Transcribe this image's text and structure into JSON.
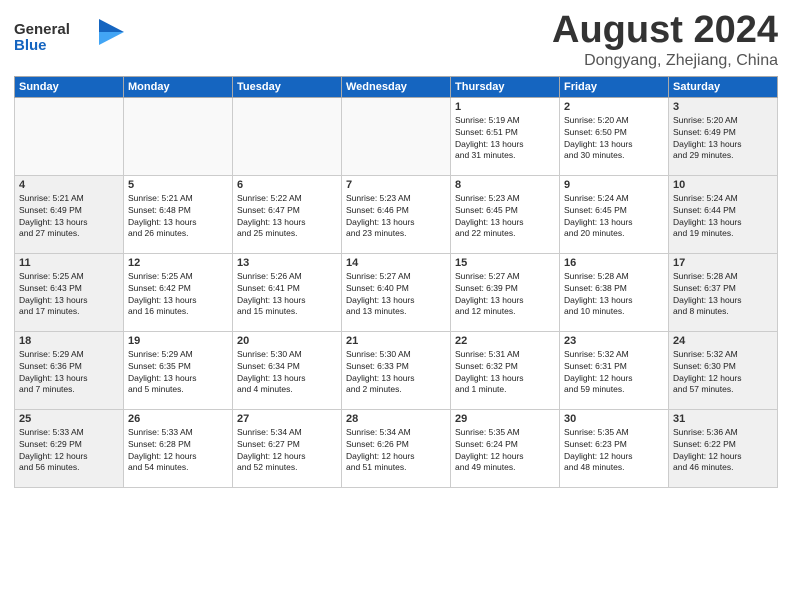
{
  "header": {
    "logo_line1": "General",
    "logo_line2": "Blue",
    "month": "August 2024",
    "location": "Dongyang, Zhejiang, China"
  },
  "days_of_week": [
    "Sunday",
    "Monday",
    "Tuesday",
    "Wednesday",
    "Thursday",
    "Friday",
    "Saturday"
  ],
  "weeks": [
    [
      {
        "day": "",
        "info": ""
      },
      {
        "day": "",
        "info": ""
      },
      {
        "day": "",
        "info": ""
      },
      {
        "day": "",
        "info": ""
      },
      {
        "day": "1",
        "info": "Sunrise: 5:19 AM\nSunset: 6:51 PM\nDaylight: 13 hours\nand 31 minutes."
      },
      {
        "day": "2",
        "info": "Sunrise: 5:20 AM\nSunset: 6:50 PM\nDaylight: 13 hours\nand 30 minutes."
      },
      {
        "day": "3",
        "info": "Sunrise: 5:20 AM\nSunset: 6:49 PM\nDaylight: 13 hours\nand 29 minutes."
      }
    ],
    [
      {
        "day": "4",
        "info": "Sunrise: 5:21 AM\nSunset: 6:49 PM\nDaylight: 13 hours\nand 27 minutes."
      },
      {
        "day": "5",
        "info": "Sunrise: 5:21 AM\nSunset: 6:48 PM\nDaylight: 13 hours\nand 26 minutes."
      },
      {
        "day": "6",
        "info": "Sunrise: 5:22 AM\nSunset: 6:47 PM\nDaylight: 13 hours\nand 25 minutes."
      },
      {
        "day": "7",
        "info": "Sunrise: 5:23 AM\nSunset: 6:46 PM\nDaylight: 13 hours\nand 23 minutes."
      },
      {
        "day": "8",
        "info": "Sunrise: 5:23 AM\nSunset: 6:45 PM\nDaylight: 13 hours\nand 22 minutes."
      },
      {
        "day": "9",
        "info": "Sunrise: 5:24 AM\nSunset: 6:45 PM\nDaylight: 13 hours\nand 20 minutes."
      },
      {
        "day": "10",
        "info": "Sunrise: 5:24 AM\nSunset: 6:44 PM\nDaylight: 13 hours\nand 19 minutes."
      }
    ],
    [
      {
        "day": "11",
        "info": "Sunrise: 5:25 AM\nSunset: 6:43 PM\nDaylight: 13 hours\nand 17 minutes."
      },
      {
        "day": "12",
        "info": "Sunrise: 5:25 AM\nSunset: 6:42 PM\nDaylight: 13 hours\nand 16 minutes."
      },
      {
        "day": "13",
        "info": "Sunrise: 5:26 AM\nSunset: 6:41 PM\nDaylight: 13 hours\nand 15 minutes."
      },
      {
        "day": "14",
        "info": "Sunrise: 5:27 AM\nSunset: 6:40 PM\nDaylight: 13 hours\nand 13 minutes."
      },
      {
        "day": "15",
        "info": "Sunrise: 5:27 AM\nSunset: 6:39 PM\nDaylight: 13 hours\nand 12 minutes."
      },
      {
        "day": "16",
        "info": "Sunrise: 5:28 AM\nSunset: 6:38 PM\nDaylight: 13 hours\nand 10 minutes."
      },
      {
        "day": "17",
        "info": "Sunrise: 5:28 AM\nSunset: 6:37 PM\nDaylight: 13 hours\nand 8 minutes."
      }
    ],
    [
      {
        "day": "18",
        "info": "Sunrise: 5:29 AM\nSunset: 6:36 PM\nDaylight: 13 hours\nand 7 minutes."
      },
      {
        "day": "19",
        "info": "Sunrise: 5:29 AM\nSunset: 6:35 PM\nDaylight: 13 hours\nand 5 minutes."
      },
      {
        "day": "20",
        "info": "Sunrise: 5:30 AM\nSunset: 6:34 PM\nDaylight: 13 hours\nand 4 minutes."
      },
      {
        "day": "21",
        "info": "Sunrise: 5:30 AM\nSunset: 6:33 PM\nDaylight: 13 hours\nand 2 minutes."
      },
      {
        "day": "22",
        "info": "Sunrise: 5:31 AM\nSunset: 6:32 PM\nDaylight: 13 hours\nand 1 minute."
      },
      {
        "day": "23",
        "info": "Sunrise: 5:32 AM\nSunset: 6:31 PM\nDaylight: 12 hours\nand 59 minutes."
      },
      {
        "day": "24",
        "info": "Sunrise: 5:32 AM\nSunset: 6:30 PM\nDaylight: 12 hours\nand 57 minutes."
      }
    ],
    [
      {
        "day": "25",
        "info": "Sunrise: 5:33 AM\nSunset: 6:29 PM\nDaylight: 12 hours\nand 56 minutes."
      },
      {
        "day": "26",
        "info": "Sunrise: 5:33 AM\nSunset: 6:28 PM\nDaylight: 12 hours\nand 54 minutes."
      },
      {
        "day": "27",
        "info": "Sunrise: 5:34 AM\nSunset: 6:27 PM\nDaylight: 12 hours\nand 52 minutes."
      },
      {
        "day": "28",
        "info": "Sunrise: 5:34 AM\nSunset: 6:26 PM\nDaylight: 12 hours\nand 51 minutes."
      },
      {
        "day": "29",
        "info": "Sunrise: 5:35 AM\nSunset: 6:24 PM\nDaylight: 12 hours\nand 49 minutes."
      },
      {
        "day": "30",
        "info": "Sunrise: 5:35 AM\nSunset: 6:23 PM\nDaylight: 12 hours\nand 48 minutes."
      },
      {
        "day": "31",
        "info": "Sunrise: 5:36 AM\nSunset: 6:22 PM\nDaylight: 12 hours\nand 46 minutes."
      }
    ]
  ]
}
